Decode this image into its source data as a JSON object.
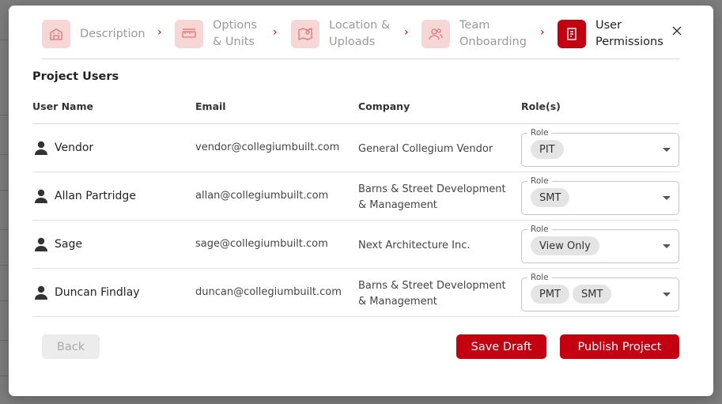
{
  "stepper": {
    "steps": [
      {
        "label": "Description",
        "icon": "building-icon",
        "active": false
      },
      {
        "label": "Options\n& Units",
        "icon": "ruler-icon",
        "active": false
      },
      {
        "label": "Location &\nUploads",
        "icon": "map-pin-icon",
        "active": false
      },
      {
        "label": "Team\nOnboarding",
        "icon": "users-icon",
        "active": false
      },
      {
        "label": "User\nPermissions",
        "icon": "document-icon",
        "active": true
      }
    ]
  },
  "section": {
    "title": "Project Users"
  },
  "table": {
    "headers": [
      "User Name",
      "Email",
      "Company",
      "Role(s)"
    ],
    "rows": [
      {
        "name": "Vendor",
        "email": "vendor@collegiumbuilt.com",
        "company": "General Collegium Vendor",
        "role_label": "Role",
        "roles": [
          "PIT"
        ]
      },
      {
        "name": "Allan Partridge",
        "email": "allan@collegiumbuilt.com",
        "company": "Barns & Street Development & Management",
        "role_label": "Role",
        "roles": [
          "SMT"
        ]
      },
      {
        "name": "Sage",
        "email": "sage@collegiumbuilt.com",
        "company": "Next Architecture Inc.",
        "role_label": "Role",
        "roles": [
          "View Only"
        ]
      },
      {
        "name": "Duncan Findlay",
        "email": "duncan@collegiumbuilt.com",
        "company": "Barns & Street Development & Management",
        "role_label": "Role",
        "roles": [
          "PMT",
          "SMT"
        ]
      }
    ]
  },
  "footer": {
    "back_label": "Back",
    "save_label": "Save Draft",
    "publish_label": "Publish Project"
  },
  "colors": {
    "accent": "#c40010",
    "step_icon_bg": "#f7d6d6",
    "chip_bg": "#e4e4e4"
  }
}
